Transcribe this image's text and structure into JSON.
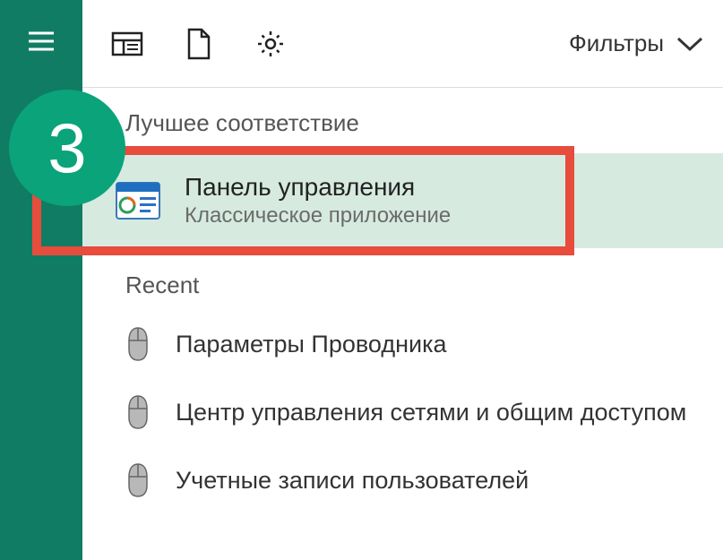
{
  "step_number": "3",
  "toolbar": {
    "filters_label": "Фильтры"
  },
  "best_match": {
    "section_label": "Лучшее соответствие",
    "title": "Панель управления",
    "subtitle": "Классическое приложение"
  },
  "recent": {
    "section_label": "Recent",
    "items": [
      {
        "label": "Параметры Проводника"
      },
      {
        "label": "Центр управления сетями и общим доступом"
      },
      {
        "label": "Учетные записи пользователей"
      }
    ]
  }
}
